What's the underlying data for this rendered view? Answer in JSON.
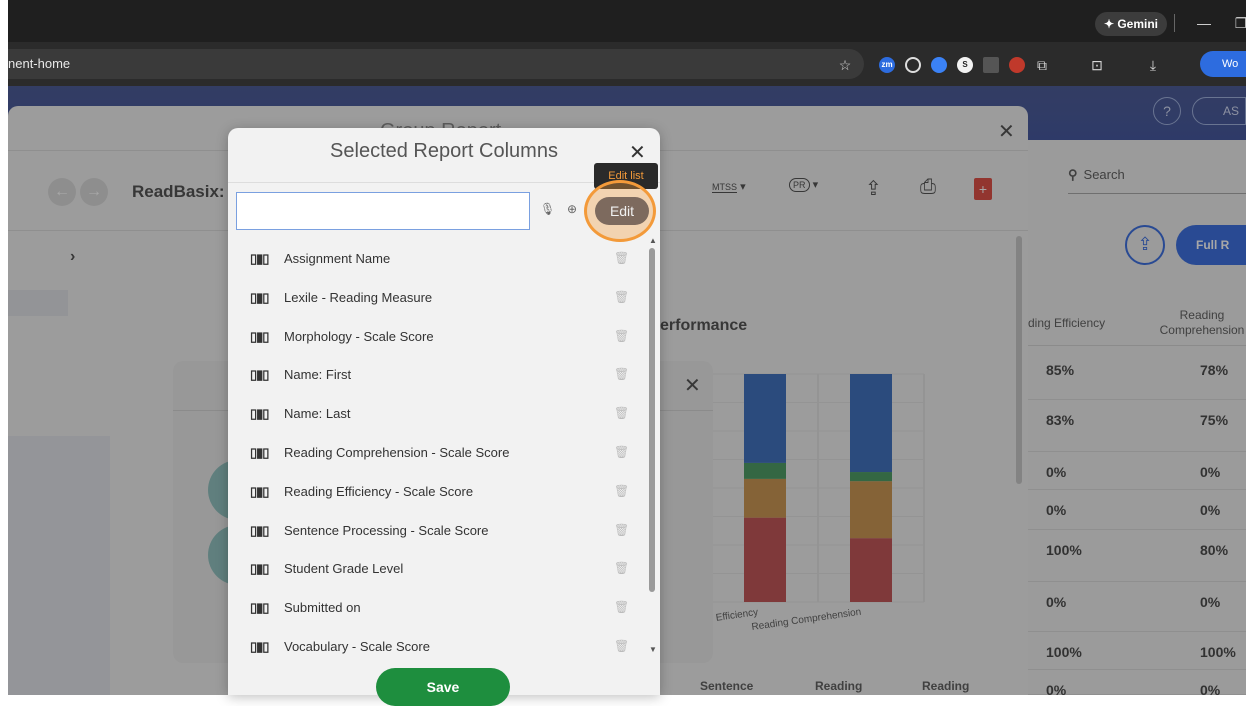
{
  "browser": {
    "url_fragment": "nent-home",
    "gemini_label": "✦ Gemini",
    "profile_label": "Wo"
  },
  "app_header": {
    "help_label": "?",
    "user_label": "AS"
  },
  "report_dialog": {
    "title_partial": "Group Report",
    "student_name_prefix": "ReadBasix:",
    "heading_partial": "erformance",
    "mtss_label": "MTSS",
    "pr_label": "PR",
    "x_labels": [
      "g Efficiency",
      "Reading Comprehension"
    ],
    "bottom_labels": [
      "Sentence",
      "Reading",
      "Reading"
    ]
  },
  "chart_data": {
    "type": "bar",
    "categories": [
      "Reading Efficiency",
      "Reading Comprehension"
    ],
    "stacked": true,
    "series": [
      {
        "color": "#b7383a",
        "values": [
          37,
          28
        ]
      },
      {
        "color": "#c28434",
        "values": [
          17,
          25
        ]
      },
      {
        "color": "#2e8b4a",
        "values": [
          7,
          4
        ]
      },
      {
        "color": "#1e58b3",
        "values": [
          39,
          43
        ]
      }
    ]
  },
  "right_table": {
    "search_placeholder": "Search",
    "full_report_label": "Full R",
    "col_headers": [
      "ding Efficiency",
      "Reading Comprehension"
    ],
    "rows": [
      [
        "85%",
        "78%"
      ],
      [
        "83%",
        "75%"
      ],
      [
        "0%",
        "0%"
      ],
      [
        "0%",
        "0%"
      ],
      [
        "100%",
        "80%"
      ],
      [
        "0%",
        "0%"
      ],
      [
        "100%",
        "100%"
      ],
      [
        "0%",
        "0%"
      ]
    ]
  },
  "modal": {
    "title": "Selected Report Columns",
    "search_value": "",
    "edit_label": "Edit",
    "tooltip": "Edit list",
    "save_label": "Save",
    "items": [
      "Assignment Name",
      "Lexile - Reading Measure",
      "Morphology - Scale Score",
      "Name: First",
      "Name: Last",
      "Reading Comprehension - Scale Score",
      "Reading Efficiency - Scale Score",
      "Sentence Processing - Scale Score",
      "Student Grade Level",
      "Submitted on",
      "Vocabulary - Scale Score"
    ]
  },
  "colors": {
    "accent_blue": "#1a56db",
    "save_green": "#1e8e3e",
    "highlight_orange": "#f39a3a"
  }
}
